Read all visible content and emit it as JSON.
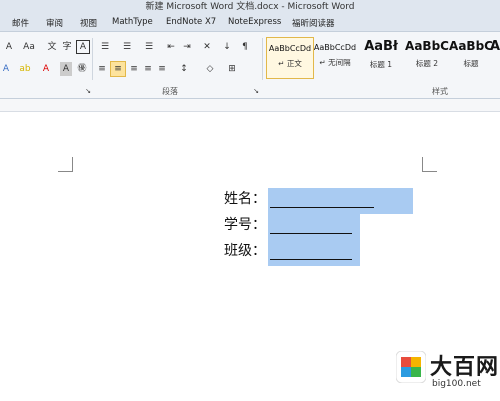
{
  "window": {
    "title": "新建 Microsoft Word 文档.docx - Microsoft Word"
  },
  "menu": {
    "items": [
      "邮件",
      "审阅",
      "视图",
      "MathType",
      "EndNote X7",
      "NoteExpress",
      "福昕阅读器"
    ]
  },
  "ribbon": {
    "groups": {
      "paragraph": "段落",
      "styles": "样式"
    },
    "styles": [
      {
        "sample": "AaBbCcDd",
        "name": "↵ 正文"
      },
      {
        "sample": "AaBbCcDd",
        "name": "↵ 无间隔"
      },
      {
        "sample": "AaBł",
        "name": "标题 1"
      },
      {
        "sample": "AaBbC",
        "name": "标题 2"
      },
      {
        "sample": "AaBbC",
        "name": "标题"
      },
      {
        "sample": "A",
        "name": ""
      }
    ]
  },
  "document": {
    "fields": [
      {
        "label": "姓名："
      },
      {
        "label": "学号："
      },
      {
        "label": "班级："
      }
    ]
  },
  "watermark": {
    "text": "大百网",
    "url": "big100.net"
  },
  "colors": {
    "selection": "#a9cbf2",
    "accent_highlight": "#fde39d"
  }
}
